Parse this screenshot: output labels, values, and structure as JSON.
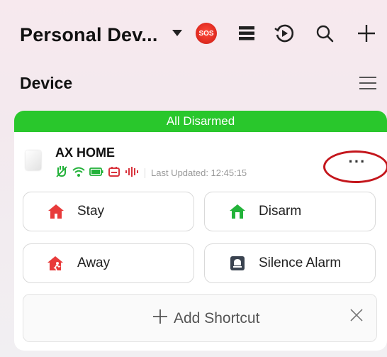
{
  "header": {
    "title": "Personal Dev...",
    "sos_label": "SOS"
  },
  "section": {
    "title": "Device"
  },
  "device": {
    "status_banner": "All Disarmed",
    "name": "AX HOME",
    "last_updated": "Last Updated: 12:45:15",
    "more_label": "···"
  },
  "actions": [
    {
      "label": "Stay",
      "icon": "home-stay-icon",
      "color": "#e83b3b"
    },
    {
      "label": "Disarm",
      "icon": "home-disarm-icon",
      "color": "#23b33a"
    },
    {
      "label": "Away",
      "icon": "home-away-icon",
      "color": "#e83b3b"
    },
    {
      "label": "Silence Alarm",
      "icon": "silence-alarm-icon",
      "color": "#3a4350"
    }
  ],
  "shortcut": {
    "label": "Add Shortcut"
  },
  "colors": {
    "banner_green": "#29c72c",
    "status_icon_green": "#22b139",
    "status_icon_red": "#d9343d",
    "annotation_red": "#c4161c"
  }
}
